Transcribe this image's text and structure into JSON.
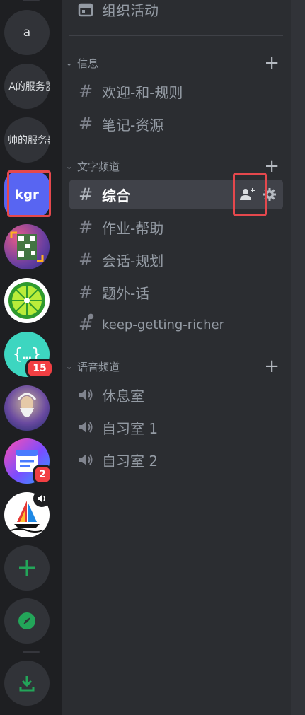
{
  "servers": {
    "s1_label": "a",
    "s2_label": "A的服务器",
    "s3_label": "帅的服务器",
    "s4_label": "kgr",
    "s7_badge": "15",
    "s9_badge": "2"
  },
  "channels": {
    "top_event": "组织活动",
    "categories": {
      "info": "信息",
      "text": "文字频道",
      "voice": "语音频道"
    },
    "info_items": [
      "欢迎-和-规则",
      "笔记-资源"
    ],
    "text_items": [
      "综合",
      "作业-帮助",
      "会话-规划",
      "题外-话",
      "keep-getting-richer"
    ],
    "voice_items": [
      "休息室",
      "自习室 1",
      "自习室 2"
    ]
  },
  "colors": {
    "accent": "#5865f2",
    "highlight": "#e5484d",
    "green": "#23a559",
    "badge": "#f23f43"
  },
  "icons": {
    "event": "calendar-icon",
    "text_channel": "hash-icon",
    "locked_text_channel": "hash-lock-icon",
    "voice_channel": "speaker-icon",
    "invite": "add-member-icon",
    "settings": "gear-icon",
    "add_server": "plus-icon",
    "discover": "compass-icon",
    "download": "download-icon"
  }
}
